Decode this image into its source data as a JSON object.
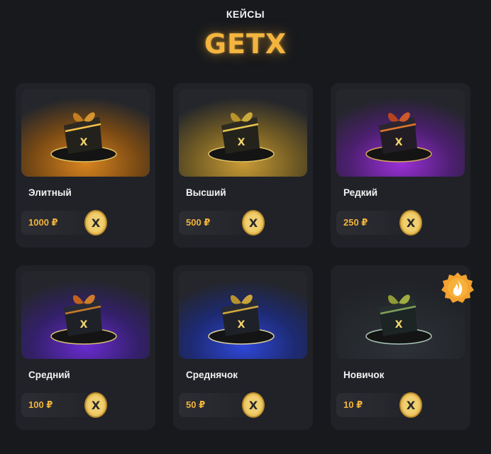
{
  "header": {
    "section_label": "КЕЙСЫ",
    "brand": "GETX"
  },
  "cases": [
    {
      "title": "Элитный",
      "price": "1000 ₽",
      "glow": "#d8841f",
      "glow2": "#7a4a14"
    },
    {
      "title": "Высший",
      "price": "500 ₽",
      "glow": "#c99a35",
      "glow2": "#6f5a24"
    },
    {
      "title": "Редкий",
      "price": "250 ₽",
      "glow": "#9a2fd6",
      "glow2": "#4b1f6e"
    },
    {
      "title": "Средний",
      "price": "100 ₽",
      "glow": "#6a2bd0",
      "glow2": "#33206a"
    },
    {
      "title": "Среднячок",
      "price": "50 ₽",
      "glow": "#2f47d8",
      "glow2": "#1d2a72"
    },
    {
      "title": "Новичок",
      "price": "10 ₽",
      "glow": "#2a2d33",
      "glow2": "#22252a"
    }
  ],
  "icons": {
    "coin": "coin-icon",
    "badge": "fire-badge-icon"
  },
  "colors": {
    "accent": "#f4b53f",
    "background": "#17191d",
    "card": "#202228"
  }
}
